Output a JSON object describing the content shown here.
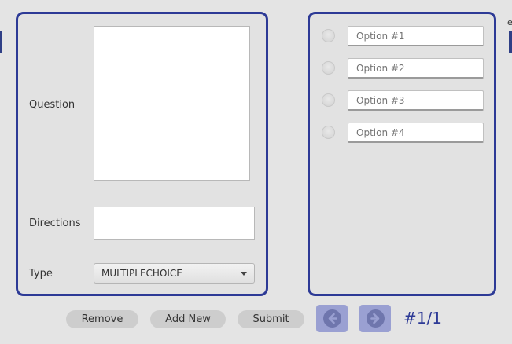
{
  "background": {
    "edge_char": "e"
  },
  "question_panel": {
    "question_label": "Question",
    "question_value": "",
    "directions_label": "Directions",
    "directions_value": "",
    "type_label": "Type",
    "type_value": "MULTIPLECHOICE"
  },
  "options_panel": {
    "options": [
      {
        "placeholder": "Option #1"
      },
      {
        "placeholder": "Option #2"
      },
      {
        "placeholder": "Option #3"
      },
      {
        "placeholder": "Option #4"
      }
    ]
  },
  "actions": {
    "remove_label": "Remove",
    "add_new_label": "Add New",
    "submit_label": "Submit"
  },
  "pagination": {
    "prev_icon": "arrow-left-icon",
    "next_icon": "arrow-right-icon",
    "indicator": "#1/1"
  },
  "colors": {
    "accent": "#2d3a96",
    "nav_button": "#9aa0d2",
    "button": "#cdcdcd"
  }
}
